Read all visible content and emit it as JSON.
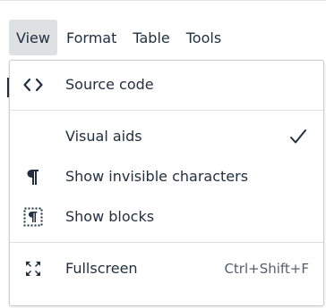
{
  "menubar": {
    "items": [
      {
        "label": "View",
        "active": true
      },
      {
        "label": "Format",
        "active": false
      },
      {
        "label": "Table",
        "active": false
      },
      {
        "label": "Tools",
        "active": false
      }
    ]
  },
  "view_menu": {
    "items": [
      {
        "label": "Source code",
        "icon": "source-code-icon"
      },
      {
        "label": "Visual aids",
        "icon": "",
        "checked": true
      },
      {
        "label": "Show invisible characters",
        "icon": "pilcrow-icon"
      },
      {
        "label": "Show blocks",
        "icon": "show-blocks-icon"
      },
      {
        "label": "Fullscreen",
        "icon": "fullscreen-icon",
        "shortcut": "Ctrl+Shift+F"
      }
    ]
  },
  "colors": {
    "text": "#222f3e",
    "active_bg": "#dee0e2",
    "border": "#cccccc"
  }
}
